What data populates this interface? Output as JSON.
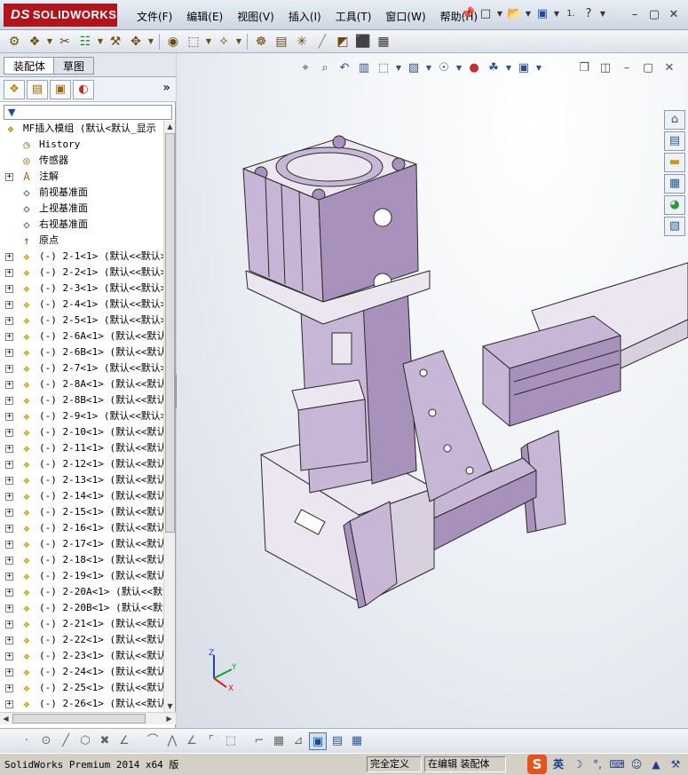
{
  "app": {
    "logo_text": "SOLIDWORKS",
    "logo_mark": "DS"
  },
  "menubar": [
    "文件(F)",
    "编辑(E)",
    "视图(V)",
    "插入(I)",
    "工具(T)",
    "窗口(W)",
    "帮助(H)"
  ],
  "quick_label": "1.",
  "panel": {
    "tabs": [
      "装配体",
      "草图"
    ],
    "more": "»",
    "filter_icon": "▼"
  },
  "tree": {
    "root": "MF插入模组  (默认<默认_显示",
    "fixed": [
      {
        "icon": "history-icon",
        "label": "History"
      },
      {
        "icon": "sensor-icon",
        "label": "传感器"
      },
      {
        "icon": "annotation-icon",
        "label": "注解"
      },
      {
        "icon": "plane-icon",
        "label": "前视基准面"
      },
      {
        "icon": "plane-icon",
        "label": "上视基准面"
      },
      {
        "icon": "plane-icon",
        "label": "右视基准面"
      },
      {
        "icon": "origin-icon",
        "label": "原点"
      }
    ],
    "components": [
      "(-) 2-1<1> (默认<<默认>",
      "(-) 2-2<1> (默认<<默认>",
      "(-) 2-3<1> (默认<<默认>",
      "(-) 2-4<1> (默认<<默认>",
      "(-) 2-5<1> (默认<<默认>",
      "(-) 2-6A<1> (默认<<默认",
      "(-) 2-6B<1> (默认<<默认",
      "(-) 2-7<1> (默认<<默认>",
      "(-) 2-8A<1> (默认<<默认",
      "(-) 2-8B<1> (默认<<默认",
      "(-) 2-9<1> (默认<<默认>",
      "(-) 2-10<1> (默认<<默认",
      "(-) 2-11<1> (默认<<默认",
      "(-) 2-12<1> (默认<<默认",
      "(-) 2-13<1> (默认<<默认",
      "(-) 2-14<1> (默认<<默认",
      "(-) 2-15<1> (默认<<默认",
      "(-) 2-16<1> (默认<<默认",
      "(-) 2-17<1> (默认<<默认",
      "(-) 2-18<1> (默认<<默认",
      "(-) 2-19<1> (默认<<默认",
      "(-) 2-20A<1> (默认<<默认",
      "(-) 2-20B<1> (默认<<默认",
      "(-) 2-21<1> (默认<<默认",
      "(-) 2-22<1> (默认<<默认",
      "(-) 2-23<1> (默认<<默认",
      "(-) 2-24<1> (默认<<默认",
      "(-) 2-25<1> (默认<<默认",
      "(-) 2-26<1> (默认<<默认"
    ]
  },
  "triad": {
    "z": "Z",
    "y": "Y",
    "x": "X"
  },
  "status": {
    "app_version": "SolidWorks Premium 2014 x64 版",
    "definition": "完全定义",
    "mode": "在编辑 装配体"
  },
  "ime": {
    "logo": "S",
    "lang": "英"
  },
  "colors": {
    "model_face": "#c8b6d6",
    "model_side": "#a892bc",
    "model_light": "#ebe6ef",
    "brand_red": "#b2141c"
  }
}
